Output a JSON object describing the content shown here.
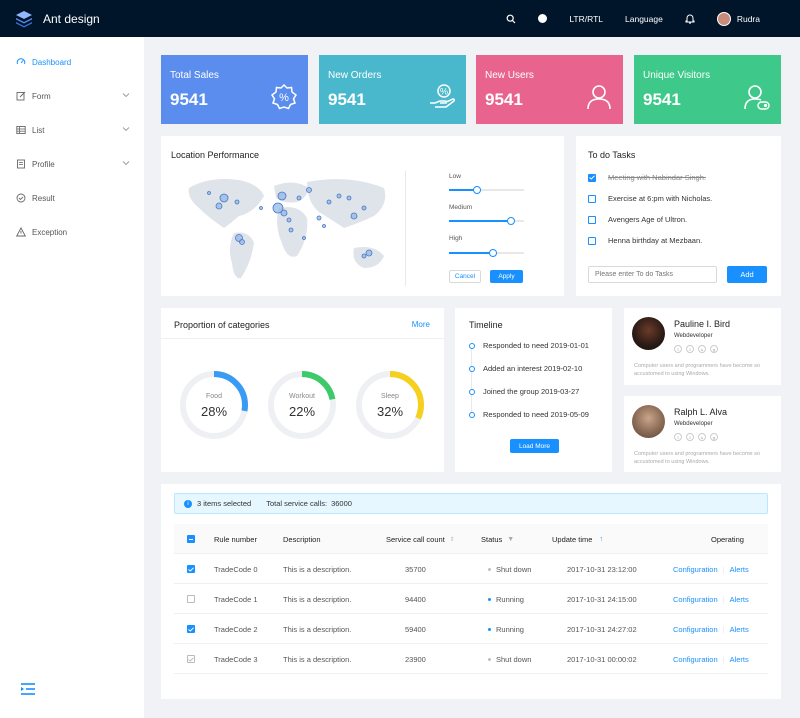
{
  "app": {
    "title": "Ant design"
  },
  "topbar": {
    "ltr_rtl": "LTR/RTL",
    "language": "Language",
    "user": "Rudra"
  },
  "sidebar": {
    "items": [
      {
        "label": "Dashboard"
      },
      {
        "label": "Form"
      },
      {
        "label": "List"
      },
      {
        "label": "Profile"
      },
      {
        "label": "Result"
      },
      {
        "label": "Exception"
      }
    ]
  },
  "stats": [
    {
      "label": "Total Sales",
      "value": "9541",
      "color": "#5b8def"
    },
    {
      "label": "New Orders",
      "value": "9541",
      "color": "#4ab8cc"
    },
    {
      "label": "New Users",
      "value": "9541",
      "color": "#e8648f"
    },
    {
      "label": "Unique Visitors",
      "value": "9541",
      "color": "#3ec98b"
    }
  ],
  "location": {
    "title": "Location Performance",
    "sliders": [
      {
        "label": "Low",
        "level": 0.37
      },
      {
        "label": "Medium",
        "level": 0.82
      },
      {
        "label": "High",
        "level": 0.58
      }
    ],
    "cancel": "Cancel",
    "apply": "Apply"
  },
  "todo": {
    "title": "To do Tasks",
    "items": [
      {
        "text": "Meeting with Nabindar Singh.",
        "done": true
      },
      {
        "text": "Exercise at 6:pm with Nicholas.",
        "done": false
      },
      {
        "text": "Avengers Age of Ultron.",
        "done": false
      },
      {
        "text": "Henna birthday at Mezbaan.",
        "done": false
      }
    ],
    "placeholder": "Please enter To do Tasks",
    "add": "Add"
  },
  "categories": {
    "title": "Proportion of categories",
    "more": "More",
    "items": [
      {
        "label": "Food",
        "value": "28%",
        "fraction": 0.28,
        "color": "#3a9bf4"
      },
      {
        "label": "Workout",
        "value": "22%",
        "fraction": 0.22,
        "color": "#3ec96a"
      },
      {
        "label": "Sleep",
        "value": "32%",
        "fraction": 0.32,
        "color": "#f5d01f"
      }
    ]
  },
  "timeline": {
    "title": "Timeline",
    "items": [
      "Responded to need 2019-01-01",
      "Added an interest 2019-02-10",
      "Joined the group 2019-03-27",
      "Responded to need 2019-05-09"
    ],
    "load_more": "Load More"
  },
  "profiles": [
    {
      "name": "Pauline I. Bird",
      "role": "Webdeveloper",
      "desc": "Computer users and programmers have become so accustomed to using Windows."
    },
    {
      "name": "Ralph L. Alva",
      "role": "Webdeveloper",
      "desc": "Computer users and programmers have become so accustomed to using Windows."
    }
  ],
  "table": {
    "alert": {
      "selected": "3 items selected",
      "total_label": "Total service calls:",
      "total_value": "36000"
    },
    "columns": {
      "rule": "Rule number",
      "desc": "Description",
      "calls": "Service call count",
      "status": "Status",
      "time": "Update time",
      "op": "Operating"
    },
    "rows": [
      {
        "checked": true,
        "rule": "TradeCode 0",
        "desc": "This is a description.",
        "calls": "35700",
        "status": "Shut down",
        "status_color": "#bfbfbf",
        "time": "2017-10-31  23:12:00",
        "config": "Configuration",
        "alerts": "Alerts"
      },
      {
        "checked": false,
        "rule": "TradeCode 1",
        "desc": "This is a description.",
        "calls": "94400",
        "status": "Running",
        "status_color": "#1890ff",
        "time": "2017-10-31  24:15:00",
        "config": "Configuration",
        "alerts": "Alerts"
      },
      {
        "checked": true,
        "rule": "TradeCode 2",
        "desc": "This is a description.",
        "calls": "59400",
        "status": "Running",
        "status_color": "#1890ff",
        "time": "2017-10-31  24:27:02",
        "config": "Configuration",
        "alerts": "Alerts"
      },
      {
        "checked": false,
        "rule": "TradeCode 3",
        "desc": "This is a description.",
        "calls": "23900",
        "status": "Shut down",
        "status_color": "#bfbfbf",
        "time": "2017-10-31  00:00:02",
        "config": "Configuration",
        "alerts": "Alerts"
      }
    ]
  }
}
